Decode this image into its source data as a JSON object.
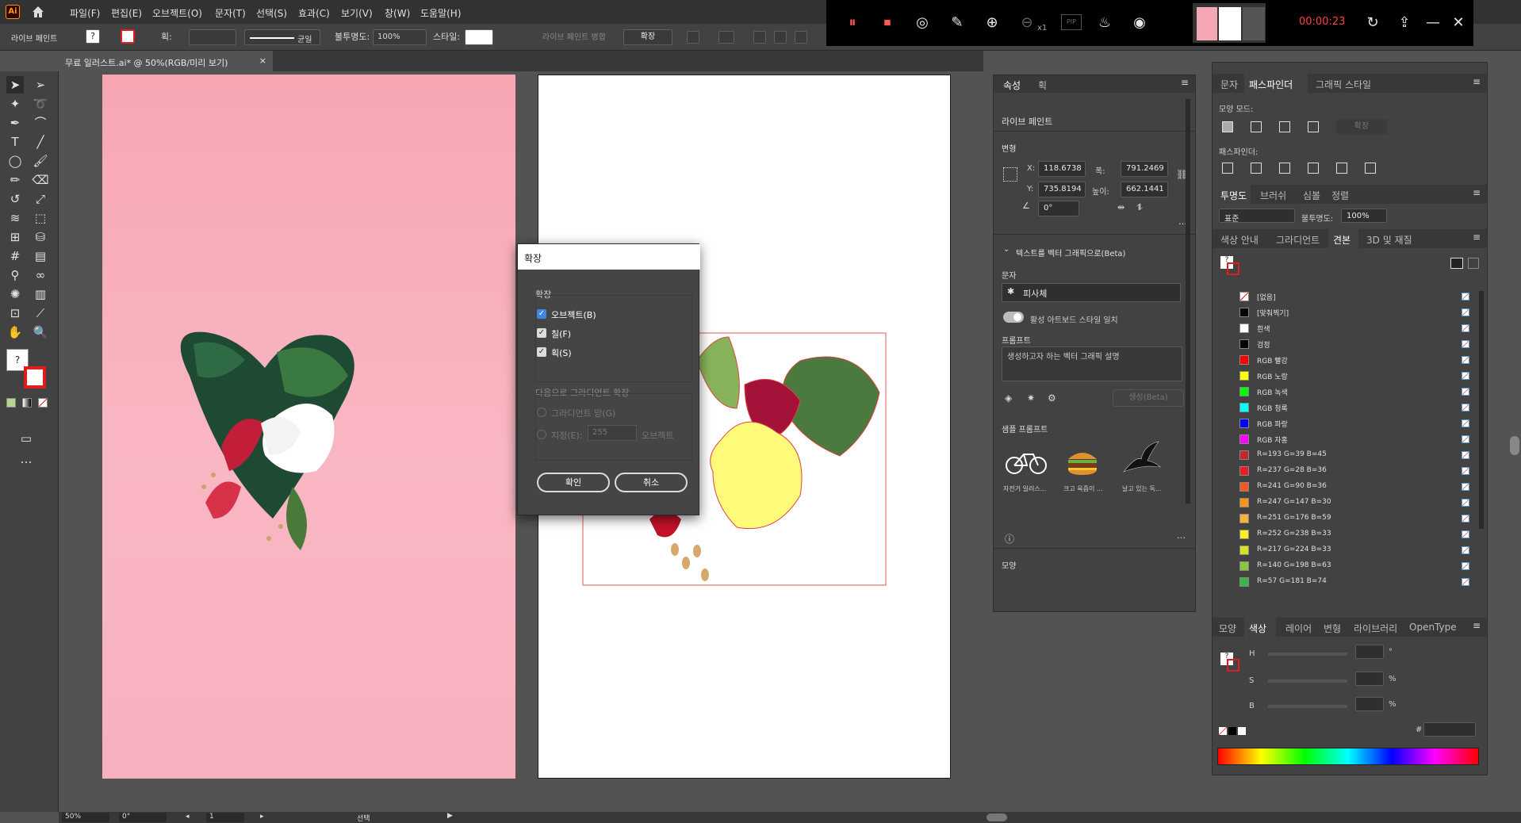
{
  "app": {
    "logo": "Ai"
  },
  "menu": [
    "파일(F)",
    "편집(E)",
    "오브젝트(O)",
    "문자(T)",
    "선택(S)",
    "효과(C)",
    "보기(V)",
    "창(W)",
    "도움말(H)"
  ],
  "control": {
    "mode_label": "라이브 페인트",
    "stroke_label": "획:",
    "stroke_profile": "균일",
    "opacity_label": "불투명도:",
    "opacity_value": "100%",
    "style_label": "스타일:",
    "merge_label": "라이브 페인트 병합",
    "expand_button": "확장"
  },
  "document": {
    "tab_title": "무료 일러스트.ai* @ 50%(RGB/미리 보기)",
    "close": "×"
  },
  "dialog": {
    "title": "확장",
    "group_expand": "확장",
    "opt_object": "오브젝트(B)",
    "opt_fill": "칠(F)",
    "opt_stroke": "획(S)",
    "group_gradient": "다음으로 그라디언트 확장",
    "opt_gradient_mesh": "그라디언트 망(G)",
    "opt_specify": "지정(E):",
    "specify_value": "255",
    "specify_unit": "오브젝트",
    "ok": "확인",
    "cancel": "취소"
  },
  "props": {
    "tabs": [
      "속성",
      "획"
    ],
    "selection_type": "라이브 페인트",
    "transform_label": "변형",
    "x_label": "X:",
    "x_value": "118.6738",
    "y_label": "Y:",
    "y_value": "735.8194",
    "w_label": "폭:",
    "w_value": "791.2469",
    "h_label": "높이:",
    "h_value": "662.1441",
    "angle_value": "0°",
    "t2v_label": "텍스트를 벡터 그래픽으로(Beta)",
    "subject_label": "문자",
    "subject_value": "피사체",
    "toggle_label": "활성 아트보드 스타일 일치",
    "prompt_label": "프롬프트",
    "prompt_placeholder": "생성하고자 하는 벡터 그래픽 설명",
    "generate_label": "생성(Beta)",
    "samples_label": "샘플 프롬프트",
    "samples": [
      "자전거 일러스...",
      "크고 육즙이 ...",
      "날고 있는 독..."
    ],
    "appearance_label": "모양"
  },
  "rightpanel": {
    "tabs_top": [
      "문자",
      "패스파인더",
      "그래픽 스타일"
    ],
    "shape_modes_label": "모양 모드:",
    "expand_btn": "확장",
    "pathfinder_label": "패스파인더:",
    "tabs_mid": [
      "투명도",
      "브러쉬",
      "심볼",
      "정렬"
    ],
    "blend_mode": "표준",
    "opacity_label": "불투명도:",
    "opacity_value": "100%",
    "tabs_sw": [
      "색상 안내",
      "그라디언트",
      "견본",
      "3D 및 재질"
    ],
    "swatches": [
      {
        "name": "[없음]",
        "color": "#ffffff"
      },
      {
        "name": "[맞춰찍기]",
        "color": "#000000"
      },
      {
        "name": "흰색",
        "color": "#ffffff"
      },
      {
        "name": "검정",
        "color": "#000000"
      },
      {
        "name": "RGB 빨강",
        "color": "#ff0000"
      },
      {
        "name": "RGB 노랑",
        "color": "#ffff00"
      },
      {
        "name": "RGB 녹색",
        "color": "#00ff00"
      },
      {
        "name": "RGB 청록",
        "color": "#00ffff"
      },
      {
        "name": "RGB 파랑",
        "color": "#0000ff"
      },
      {
        "name": "RGB 자홍",
        "color": "#ff00ff"
      },
      {
        "name": "R=193 G=39 B=45",
        "color": "#c1272d"
      },
      {
        "name": "R=237 G=28 B=36",
        "color": "#ed1c24"
      },
      {
        "name": "R=241 G=90 B=36",
        "color": "#f15a24"
      },
      {
        "name": "R=247 G=147 B=30",
        "color": "#f7931e"
      },
      {
        "name": "R=251 G=176 B=59",
        "color": "#fbb03b"
      },
      {
        "name": "R=252 G=238 B=33",
        "color": "#fcee21"
      },
      {
        "name": "R=217 G=224 B=33",
        "color": "#d9e021"
      },
      {
        "name": "R=140 G=198 B=63",
        "color": "#8cc63f"
      },
      {
        "name": "R=57 G=181 B=74",
        "color": "#39b54a"
      }
    ],
    "tabs_color": [
      "모양",
      "색상",
      "레이어",
      "변형",
      "라이브러리",
      "OpenType"
    ],
    "h_label": "H",
    "s_label": "S",
    "b_label": "B",
    "deg": "°",
    "pct1": "%",
    "pct2": "%",
    "hash": "#"
  },
  "recorder": {
    "timer": "00:00:23",
    "zoom_suffix": "x1",
    "pip": "PIP"
  },
  "status": {
    "zoom": "50%",
    "rotate": "0°",
    "artboard": "1",
    "tool": "선택"
  }
}
